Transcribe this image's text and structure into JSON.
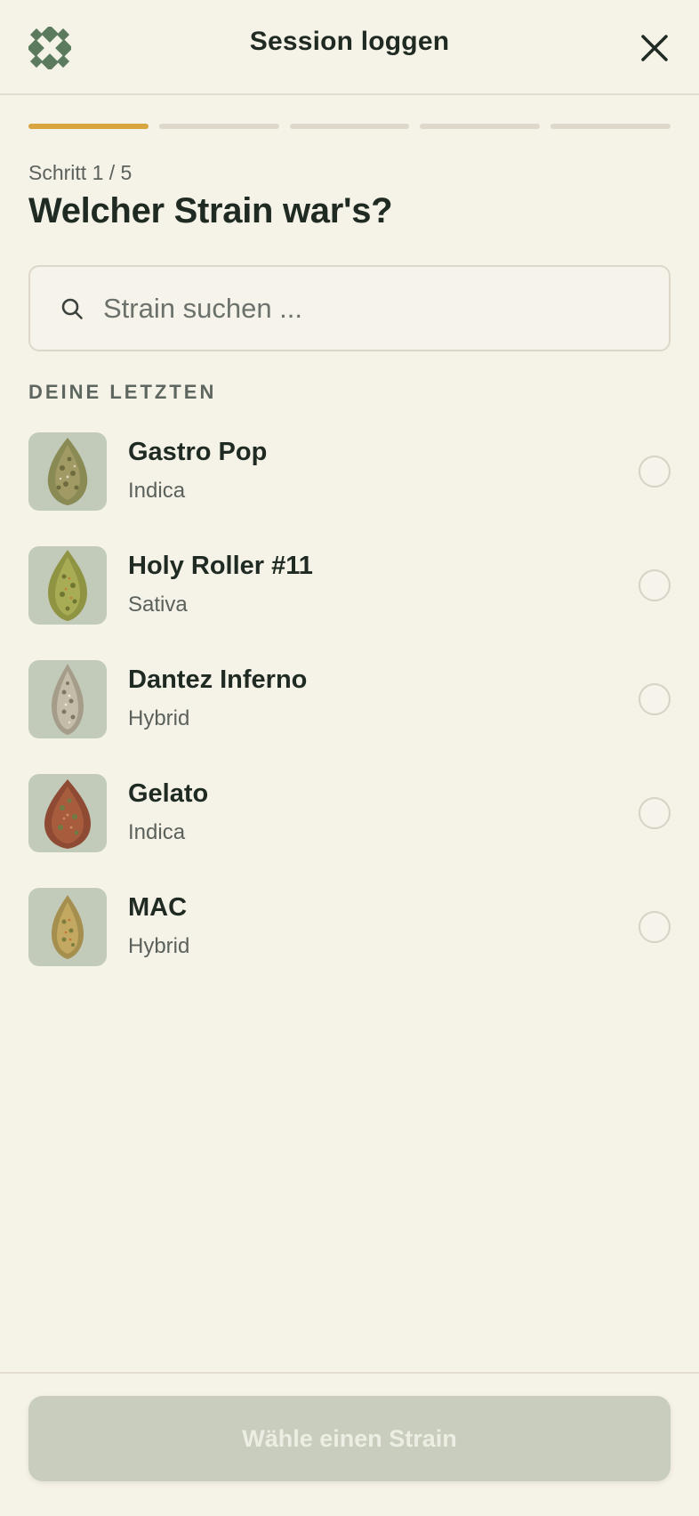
{
  "header": {
    "title": "Session loggen",
    "logo_icon": "leaf-logo-icon",
    "close_icon": "close-icon"
  },
  "progress": {
    "total_steps": 5,
    "current_step": 1
  },
  "step": {
    "label": "Schritt 1 / 5",
    "question": "Welcher Strain war's?"
  },
  "search": {
    "placeholder": "Strain suchen ...",
    "value": "",
    "icon": "search-icon"
  },
  "recent": {
    "label": "DEINE LETZTEN",
    "items": [
      {
        "name": "Gastro Pop",
        "type": "Indica",
        "selected": false
      },
      {
        "name": "Holy Roller #11",
        "type": "Sativa",
        "selected": false
      },
      {
        "name": "Dantez Inferno",
        "type": "Hybrid",
        "selected": false
      },
      {
        "name": "Gelato",
        "type": "Indica",
        "selected": false
      },
      {
        "name": "MAC",
        "type": "Hybrid",
        "selected": false
      }
    ]
  },
  "footer": {
    "cta_label": "Wähle einen Strain",
    "cta_enabled": false
  },
  "colors": {
    "background": "#f5f2e8",
    "accent": "#d7a440",
    "brand_green": "#5b7a5e",
    "text": "#1f2a22",
    "muted": "#5b615b",
    "cta_disabled": "#c9cdbe"
  }
}
